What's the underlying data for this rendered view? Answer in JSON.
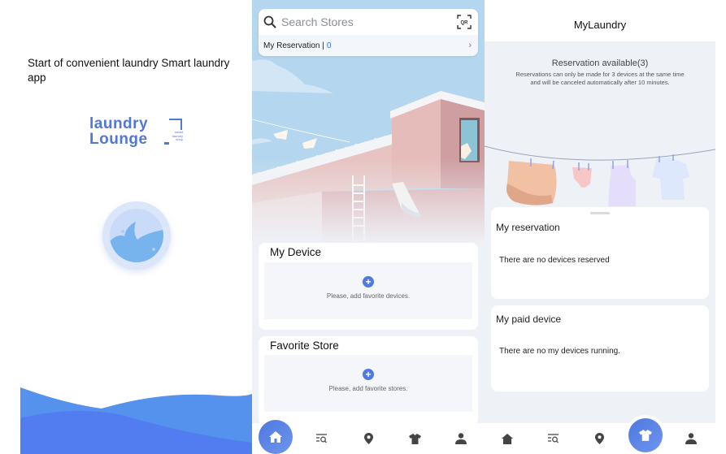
{
  "splash": {
    "title": "Start of convenient laundry Smart laundry app",
    "logo": {
      "line1": "laundry",
      "line2": "Lounge",
      "tagline": [
        "smart",
        "laundry",
        "shop"
      ],
      "color": "#5277d6"
    }
  },
  "home": {
    "search_placeholder": "Search Stores",
    "qr_label": "QR",
    "reservation_label": "My Reservation |",
    "reservation_count": "0",
    "my_device": {
      "title": "My Device",
      "empty_message": "Please, add favorite devices."
    },
    "favorite_store": {
      "title": "Favorite Store",
      "empty_message": "Please, add favorite stores."
    },
    "nav": [
      {
        "name": "home",
        "icon": "home-icon",
        "active": true
      },
      {
        "name": "store-list",
        "icon": "list-search-icon",
        "active": false
      },
      {
        "name": "map",
        "icon": "location-pin-icon",
        "active": false
      },
      {
        "name": "my-laundry",
        "icon": "shirt-icon",
        "active": false
      },
      {
        "name": "profile",
        "icon": "person-icon",
        "active": false
      }
    ]
  },
  "mylaundry": {
    "title": "MyLaundry",
    "availability_title": "Reservation available(3)",
    "availability_desc_line1": "Reservations can only be made for 3 devices at the same time",
    "availability_desc_line2": "and will be canceled automatically after 10 minutes.",
    "my_reservation": {
      "title": "My reservation",
      "empty_message": "There are no devices reserved"
    },
    "my_paid_device": {
      "title": "My paid device",
      "empty_message": "There are no my devices running."
    },
    "nav": [
      {
        "name": "home",
        "icon": "home-icon",
        "active": false
      },
      {
        "name": "store-list",
        "icon": "list-search-icon",
        "active": false
      },
      {
        "name": "map",
        "icon": "location-pin-icon",
        "active": false
      },
      {
        "name": "my-laundry",
        "icon": "shirt-icon",
        "active": true
      },
      {
        "name": "profile",
        "icon": "person-icon",
        "active": false
      }
    ]
  },
  "colors": {
    "accent": "#4f7ae0",
    "sky": "#b5d6ef",
    "building": "#d8a9ab",
    "background": "#eef1f6"
  }
}
